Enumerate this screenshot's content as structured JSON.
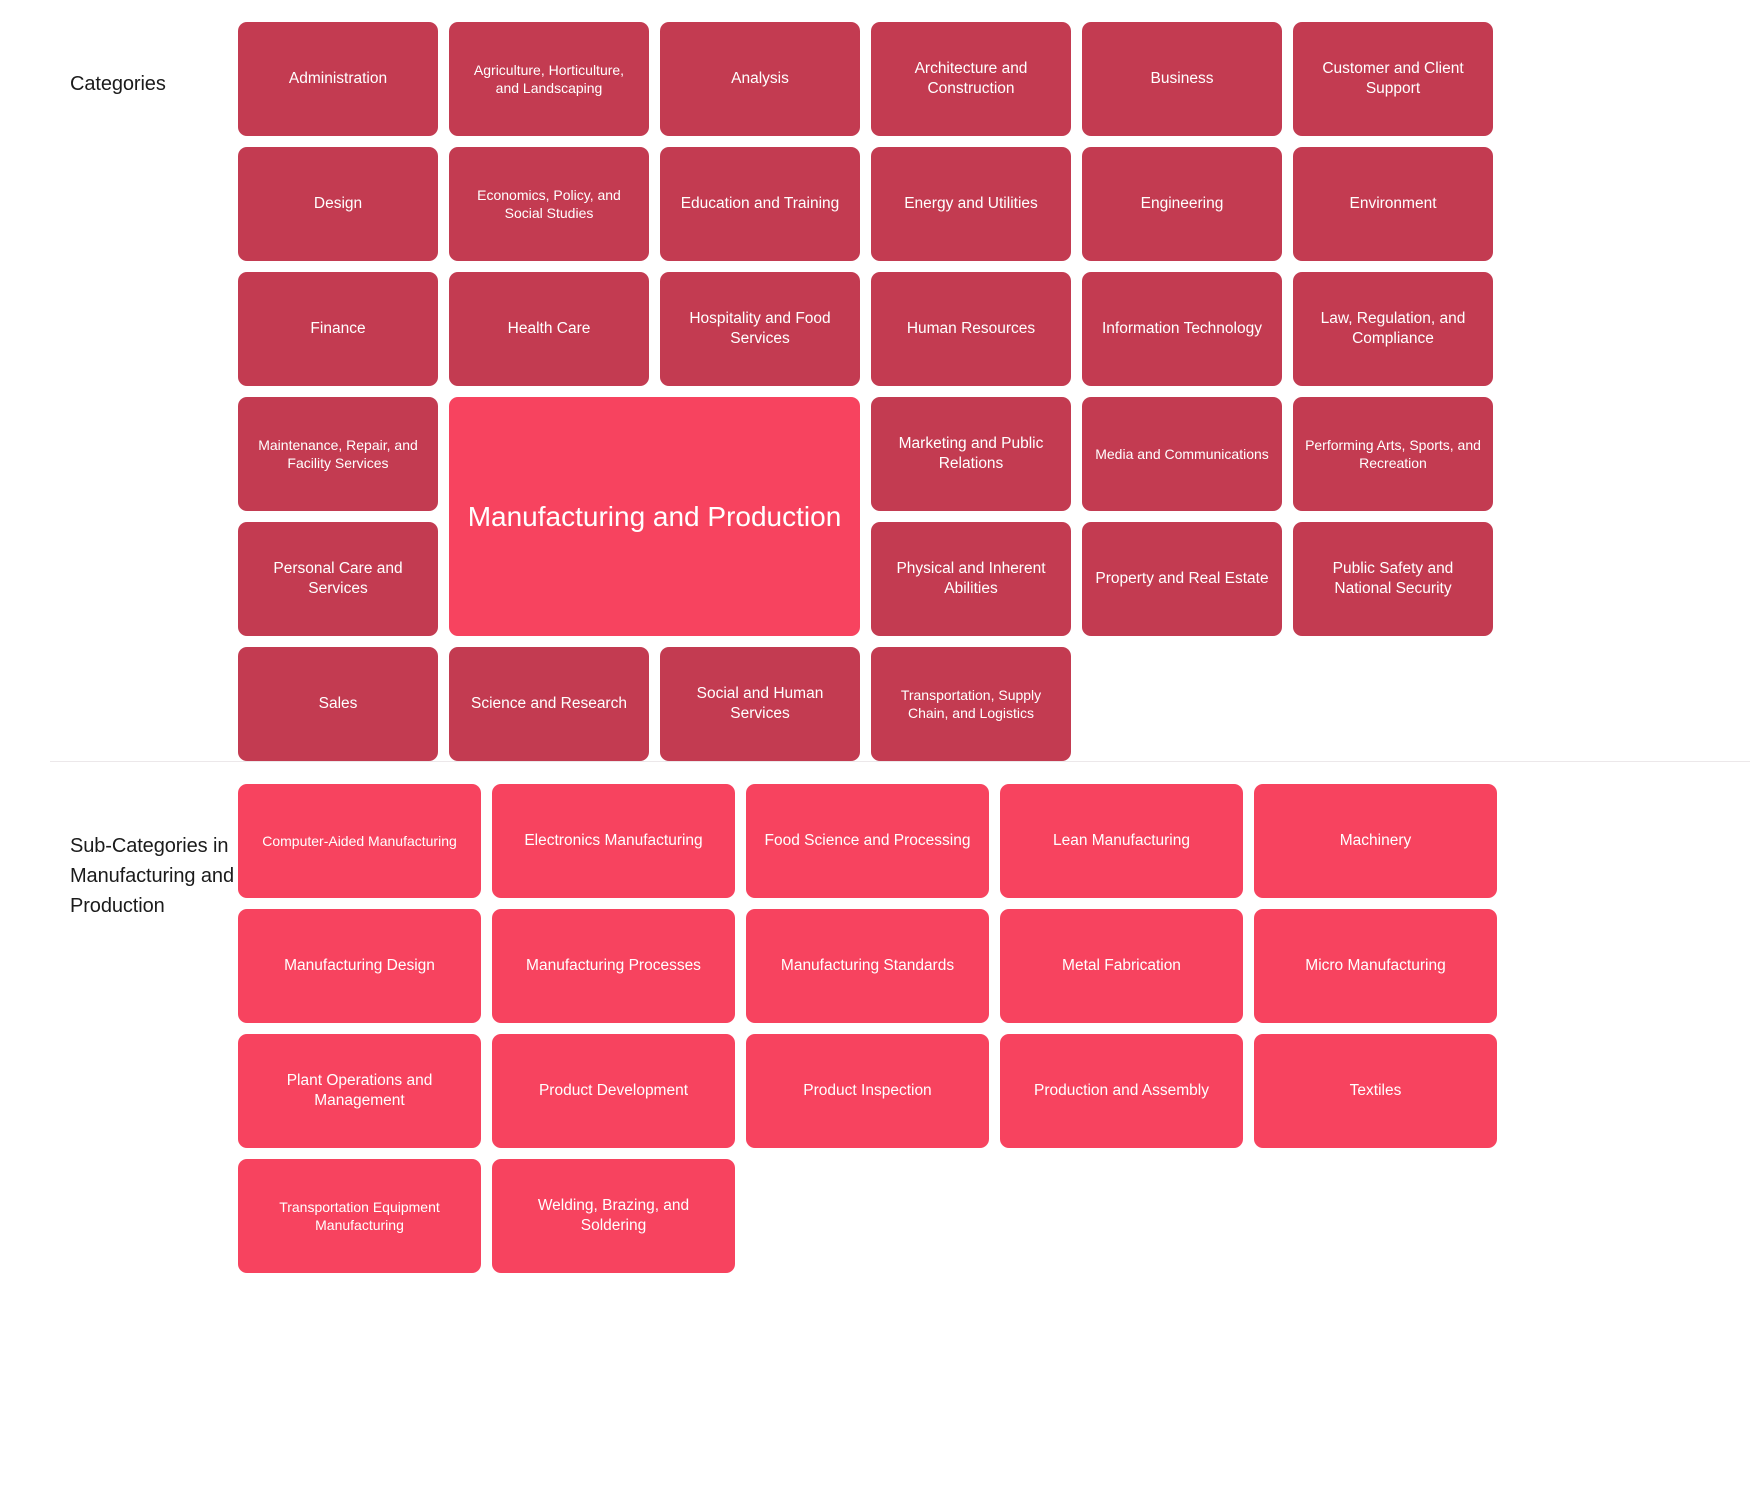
{
  "theme": {
    "background": "#ffffff",
    "tile_default": "#c33b51",
    "tile_highlight": "#f7435f",
    "tile_text": "#ffffff",
    "label_text": "#1b1b1b",
    "divider": "#ece8ea"
  },
  "categories_section": {
    "label": "Categories",
    "columns": 6,
    "selected": "Manufacturing and Production",
    "tiles": [
      {
        "label": "Administration",
        "selected": false,
        "small": false
      },
      {
        "label": "Agriculture, Horticulture, and Landscaping",
        "selected": false,
        "small": true
      },
      {
        "label": "Analysis",
        "selected": false,
        "small": false
      },
      {
        "label": "Architecture and Construction",
        "selected": false,
        "small": false
      },
      {
        "label": "Business",
        "selected": false,
        "small": false
      },
      {
        "label": "Customer and Client Support",
        "selected": false,
        "small": false
      },
      {
        "label": "Design",
        "selected": false,
        "small": false
      },
      {
        "label": "Economics, Policy, and Social Studies",
        "selected": false,
        "small": true
      },
      {
        "label": "Education and Training",
        "selected": false,
        "small": false
      },
      {
        "label": "Energy and Utilities",
        "selected": false,
        "small": false
      },
      {
        "label": "Engineering",
        "selected": false,
        "small": false
      },
      {
        "label": "Environment",
        "selected": false,
        "small": false
      },
      {
        "label": "Finance",
        "selected": false,
        "small": false
      },
      {
        "label": "Health Care",
        "selected": false,
        "small": false
      },
      {
        "label": "Hospitality and Food Services",
        "selected": false,
        "small": false
      },
      {
        "label": "Human Resources",
        "selected": false,
        "small": false
      },
      {
        "label": "Information Technology",
        "selected": false,
        "small": false
      },
      {
        "label": "Law, Regulation, and Compliance",
        "selected": false,
        "small": false
      },
      {
        "label": "Maintenance, Repair, and Facility Services",
        "selected": false,
        "small": true
      },
      {
        "label": "Manufacturing and Production",
        "selected": true,
        "small": false,
        "span": "2x2"
      },
      {
        "label": "Marketing and Public Relations",
        "selected": false,
        "small": false
      },
      {
        "label": "Media and Communications",
        "selected": false,
        "small": true
      },
      {
        "label": "Performing Arts, Sports, and Recreation",
        "selected": false,
        "small": true
      },
      {
        "label": "Personal Care and Services",
        "selected": false,
        "small": false
      },
      {
        "label": "Physical and Inherent Abilities",
        "selected": false,
        "small": false
      },
      {
        "label": "Property and Real Estate",
        "selected": false,
        "small": false
      },
      {
        "label": "Public Safety and National Security",
        "selected": false,
        "small": false
      },
      {
        "label": "Sales",
        "selected": false,
        "small": false
      },
      {
        "label": "Science and Research",
        "selected": false,
        "small": false
      },
      {
        "label": "Social and Human Services",
        "selected": false,
        "small": false
      },
      {
        "label": "Transportation, Supply Chain, and Logistics",
        "selected": false,
        "small": true
      }
    ]
  },
  "subcategories_section": {
    "label": "Sub-Categories in Manufacturing and Production",
    "columns": 5,
    "tiles": [
      {
        "label": "Computer-Aided Manufacturing",
        "small": true
      },
      {
        "label": "Electronics Manufacturing",
        "small": false
      },
      {
        "label": "Food Science and Processing",
        "small": false
      },
      {
        "label": "Lean Manufacturing",
        "small": false
      },
      {
        "label": "Machinery",
        "small": false
      },
      {
        "label": "Manufacturing Design",
        "small": false
      },
      {
        "label": "Manufacturing Processes",
        "small": false
      },
      {
        "label": "Manufacturing Standards",
        "small": false
      },
      {
        "label": "Metal Fabrication",
        "small": false
      },
      {
        "label": "Micro Manufacturing",
        "small": false
      },
      {
        "label": "Plant Operations and Management",
        "small": false
      },
      {
        "label": "Product Development",
        "small": false
      },
      {
        "label": "Product Inspection",
        "small": false
      },
      {
        "label": "Production and Assembly",
        "small": false
      },
      {
        "label": "Textiles",
        "small": false
      },
      {
        "label": "Transportation Equipment Manufacturing",
        "small": true
      },
      {
        "label": "Welding, Brazing, and Soldering",
        "small": false
      }
    ]
  }
}
